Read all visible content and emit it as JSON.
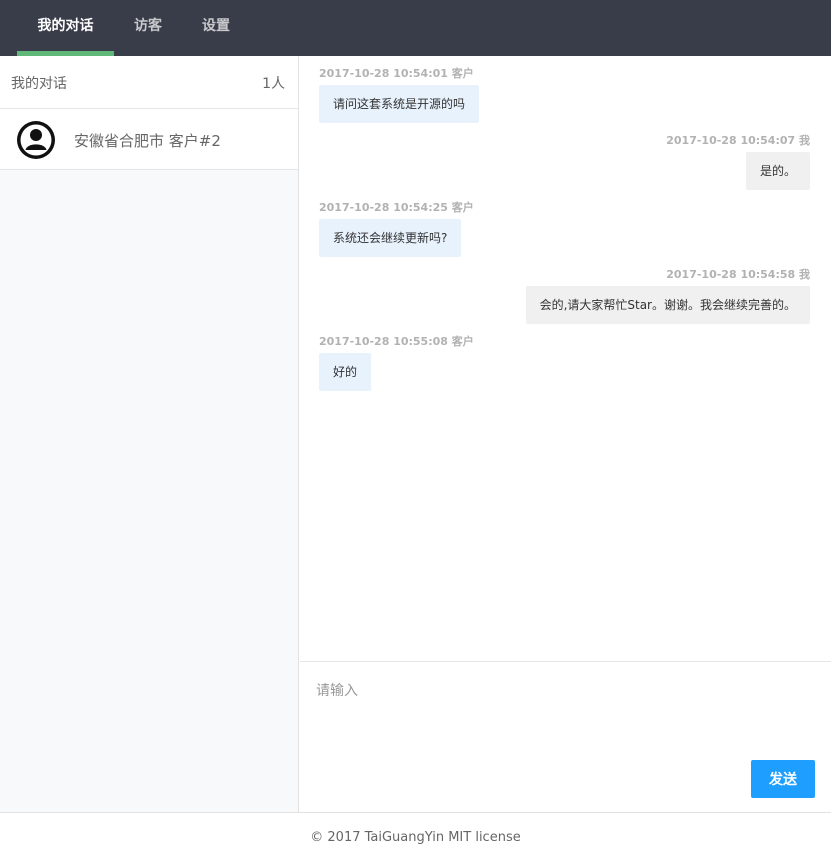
{
  "nav": {
    "tabs": [
      {
        "label": "我的对话",
        "active": true
      },
      {
        "label": "访客",
        "active": false
      },
      {
        "label": "设置",
        "active": false
      }
    ],
    "accent_color": "#5fb878",
    "background_color": "#393d49"
  },
  "sidebar": {
    "title": "我的对话",
    "count": "1人",
    "conversations": [
      {
        "name": "安徽省合肥市 客户#2",
        "icon": "user-avatar-icon"
      }
    ]
  },
  "chat": {
    "messages": [
      {
        "meta": "2017-10-28 10:54:01 客户",
        "text": "请问这套系统是开源的吗",
        "side": "left"
      },
      {
        "meta": "2017-10-28 10:54:07 我",
        "text": "是的。",
        "side": "right"
      },
      {
        "meta": "2017-10-28 10:54:25 客户",
        "text": "系统还会继续更新吗?",
        "side": "left"
      },
      {
        "meta": "2017-10-28 10:54:58 我",
        "text": "会的,请大家帮忙Star。谢谢。我会继续完善的。",
        "side": "right"
      },
      {
        "meta": "2017-10-28 10:55:08 客户",
        "text": "好的",
        "side": "left"
      }
    ],
    "customer_bubble_color": "#e8f2fd",
    "agent_bubble_color": "#f0f0f0"
  },
  "composer": {
    "placeholder": "请输入",
    "value": "",
    "send_label": "发送",
    "send_color": "#1e9fff"
  },
  "footer": {
    "text": "© 2017 TaiGuangYin MIT license"
  }
}
